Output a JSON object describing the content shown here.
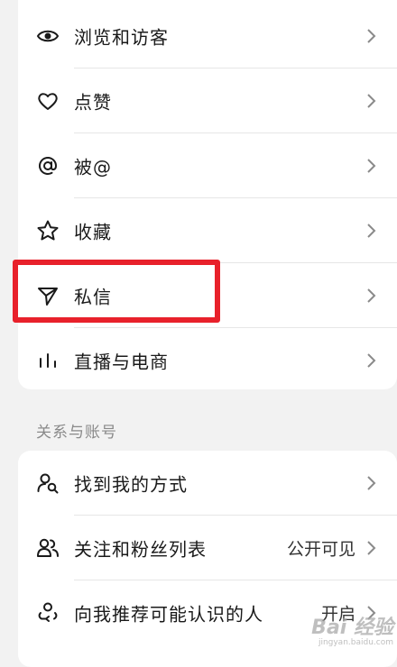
{
  "section1": {
    "items": [
      {
        "label": "浏览和访客",
        "icon": "eye-icon"
      },
      {
        "label": "点赞",
        "icon": "heart-icon"
      },
      {
        "label": "被@",
        "icon": "at-icon"
      },
      {
        "label": "收藏",
        "icon": "star-icon"
      },
      {
        "label": "私信",
        "icon": "paper-plane-icon"
      },
      {
        "label": "直播与电商",
        "icon": "bar-chart-icon"
      }
    ]
  },
  "section2": {
    "title": "关系与账号",
    "items": [
      {
        "label": "找到我的方式",
        "icon": "person-search-icon",
        "value": ""
      },
      {
        "label": "关注和粉丝列表",
        "icon": "people-icon",
        "value": "公开可见"
      },
      {
        "label": "向我推荐可能认识的人",
        "icon": "person-recommend-icon",
        "value": "开启"
      }
    ]
  },
  "colors": {
    "highlight_box": "#e8212b",
    "background": "#f2f2f2",
    "card": "#ffffff"
  },
  "watermark": {
    "main": "Bai 经验",
    "sub": "jingyan.baidu.com"
  }
}
